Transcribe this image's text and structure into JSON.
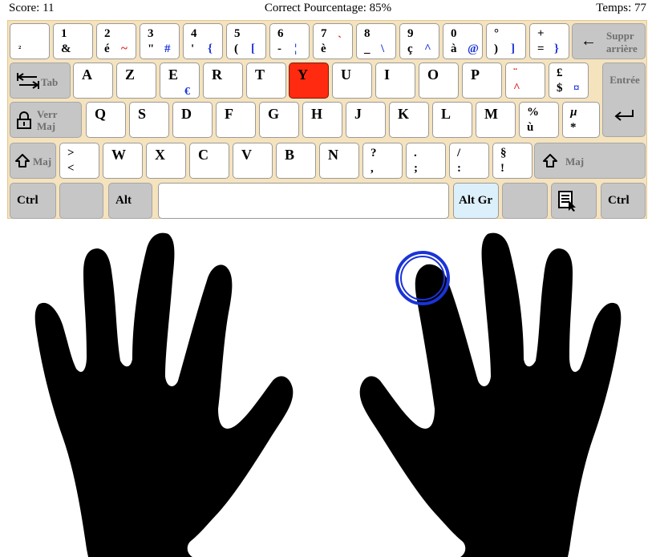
{
  "status": {
    "score_label": "Score: 11",
    "correct_label": "Correct Pourcentage: 85%",
    "time_label": "Temps: 77"
  },
  "keys": {
    "sup2": "²",
    "k1_top": "1",
    "k1_bot": "&",
    "k2_top": "2",
    "k2_bot": "é",
    "k2_alt": "~",
    "k3_top": "3",
    "k3_bot": "\"",
    "k3_alt": "#",
    "k4_top": "4",
    "k4_bot": "'",
    "k4_alt": "{",
    "k5_top": "5",
    "k5_bot": "(",
    "k5_alt": "[",
    "k6_top": "6",
    "k6_bot": "-",
    "k6_alt": "¦",
    "k7_top": "7",
    "k7_bot": "è",
    "k7_alt": "`",
    "k8_top": "8",
    "k8_bot": "_",
    "k8_alt": "\\",
    "k9_top": "9",
    "k9_bot": "ç",
    "k9_alt": "^",
    "k0_top": "0",
    "k0_bot": "à",
    "k0_alt": "@",
    "deg_top": "°",
    "deg_bot": ")",
    "deg_alt": "]",
    "plus_top": "+",
    "plus_bot": "=",
    "plus_alt": "}",
    "backspace_arrow": "←",
    "backspace_l1": "Suppr",
    "backspace_l2": "arrière",
    "tab_label": "Tab",
    "a": "A",
    "z": "Z",
    "e": "E",
    "e_alt": "€",
    "r": "R",
    "t": "T",
    "y": "Y",
    "u": "U",
    "i": "I",
    "o": "O",
    "p": "P",
    "trema": "¨",
    "circ": "^",
    "pound": "£",
    "dollar": "$",
    "currency": "¤",
    "enter_label": "Entrée",
    "enter_arrow": "↵",
    "caps_l1": "Verr",
    "caps_l2": "Maj",
    "q": "Q",
    "s": "S",
    "d": "D",
    "f": "F",
    "g": "G",
    "h": "H",
    "j": "J",
    "k": "K",
    "l": "L",
    "m": "M",
    "pct_top": "%",
    "pct_bot": "ù",
    "mu_top": "µ",
    "mu_bot": "*",
    "shift_label": "Maj",
    "gt": ">",
    "lt": "<",
    "w": "W",
    "x": "X",
    "c": "C",
    "v": "V",
    "b": "B",
    "n": "N",
    "q_top": "?",
    "q_bot": ",",
    "dot_top": ".",
    "dot_bot": ";",
    "slash_top": "/",
    "slash_bot": ":",
    "para_top": "§",
    "para_bot": "!",
    "ctrl": "Ctrl",
    "alt": "Alt",
    "altgr": "Alt Gr"
  },
  "target_key": "Y",
  "colors": {
    "keyboard_bg": "#f5e3be",
    "target_key": "#ff2a10",
    "altgr_key": "#dcf0fb",
    "function_key": "#c6c6c6",
    "alt_symbol_blue": "#1a33d6",
    "dead_key_red": "#e41a14",
    "finger_ring": "#1a33d6"
  },
  "finger_indicator": "right-index"
}
